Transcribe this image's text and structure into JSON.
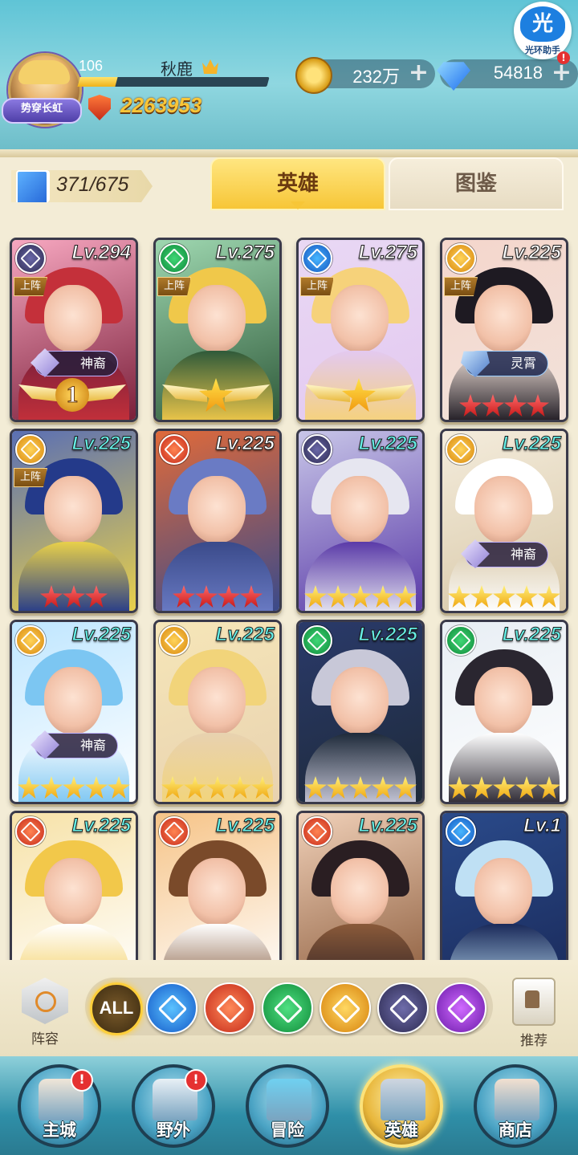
{
  "header": {
    "player_level": "106",
    "player_name": "秋鹿",
    "title_badge": "势穿长虹",
    "xp_progress": 0.2,
    "combat_power": "2263953",
    "gold": "232万",
    "gems": "54818",
    "gold_plus": "+",
    "gems_plus": "+",
    "helper_glyph": "光",
    "helper_label": "光环助手",
    "helper_alert": "!"
  },
  "tabs": {
    "hero_count": "371/675",
    "heroes": "英雄",
    "codex": "图鉴"
  },
  "heroes": [
    {
      "level": "Lv.294",
      "faction": "dark",
      "level_color": "white",
      "deployed": "上阵",
      "badge": "神裔",
      "badge_kind": "shen",
      "wings": "num",
      "wing_value": "1",
      "stars": 0,
      "star_color": "",
      "palette": [
        "#f7a7c0",
        "#c4303a",
        "#7a1f3a"
      ]
    },
    {
      "level": "Lv.275",
      "faction": "nature",
      "level_color": "white",
      "deployed": "上阵",
      "badge": "",
      "badge_kind": "",
      "wings": "star",
      "wing_value": "",
      "stars": 0,
      "star_color": "",
      "palette": [
        "#9ed7b0",
        "#f0c84a",
        "#2f5a3a"
      ]
    },
    {
      "level": "Lv.275",
      "faction": "water",
      "level_color": "white",
      "deployed": "上阵",
      "badge": "",
      "badge_kind": "",
      "wings": "star",
      "wing_value": "",
      "stars": 0,
      "star_color": "",
      "palette": [
        "#e9d8f4",
        "#f6d27a",
        "#e3c9f0"
      ]
    },
    {
      "level": "Lv.225",
      "faction": "light",
      "level_color": "white",
      "deployed": "上阵",
      "badge": "灵霄",
      "badge_kind": "ling",
      "wings": "",
      "wing_value": "",
      "stars": 4,
      "star_color": "red",
      "palette": [
        "#f4d6cc",
        "#1e1a22",
        "#f2e2da"
      ]
    },
    {
      "level": "Lv.225",
      "faction": "light",
      "level_color": "teal",
      "deployed": "上阵",
      "badge": "",
      "badge_kind": "",
      "wings": "",
      "wing_value": "",
      "stars": 3,
      "star_color": "red",
      "palette": [
        "#5a6fb4",
        "#243a8a",
        "#e8d04a"
      ]
    },
    {
      "level": "Lv.225",
      "faction": "fire",
      "level_color": "white",
      "deployed": "",
      "badge": "",
      "badge_kind": "",
      "wings": "",
      "wing_value": "",
      "stars": 4,
      "star_color": "red",
      "palette": [
        "#e06a3a",
        "#6a7bc4",
        "#3a4a8a"
      ]
    },
    {
      "level": "Lv.225",
      "faction": "dark",
      "level_color": "teal",
      "deployed": "",
      "badge": "",
      "badge_kind": "",
      "wings": "",
      "wing_value": "",
      "stars": 5,
      "star_color": "gold",
      "palette": [
        "#c8c6e8",
        "#e6e6f0",
        "#5a3aa8"
      ]
    },
    {
      "level": "Lv.225",
      "faction": "light",
      "level_color": "teal",
      "deployed": "",
      "badge": "神裔",
      "badge_kind": "shen",
      "wings": "",
      "wing_value": "",
      "stars": 5,
      "star_color": "gold",
      "palette": [
        "#f4ecdc",
        "#ffffff",
        "#d8c8a8"
      ]
    },
    {
      "level": "Lv.225",
      "faction": "light",
      "level_color": "teal",
      "deployed": "",
      "badge": "神裔",
      "badge_kind": "shen",
      "wings": "",
      "wing_value": "",
      "stars": 5,
      "star_color": "gold",
      "palette": [
        "#bfe6ff",
        "#7cc6f2",
        "#ffffff"
      ]
    },
    {
      "level": "Lv.225",
      "faction": "light",
      "level_color": "teal",
      "deployed": "",
      "badge": "",
      "badge_kind": "",
      "wings": "",
      "wing_value": "",
      "stars": 5,
      "star_color": "gold",
      "palette": [
        "#f6e6b8",
        "#f2d47a",
        "#e8d2b0"
      ]
    },
    {
      "level": "Lv.225",
      "faction": "nature",
      "level_color": "teal",
      "deployed": "",
      "badge": "",
      "badge_kind": "",
      "wings": "",
      "wing_value": "",
      "stars": 5,
      "star_color": "gold",
      "palette": [
        "#2a3a6a",
        "#c8c8d8",
        "#1e2a3a"
      ]
    },
    {
      "level": "Lv.225",
      "faction": "nature",
      "level_color": "teal",
      "deployed": "",
      "badge": "",
      "badge_kind": "",
      "wings": "",
      "wing_value": "",
      "stars": 5,
      "star_color": "gold",
      "palette": [
        "#e8eef4",
        "#2a2630",
        "#ffffff"
      ]
    },
    {
      "level": "Lv.225",
      "faction": "fire",
      "level_color": "teal",
      "deployed": "",
      "badge": "",
      "badge_kind": "",
      "wings": "",
      "wing_value": "",
      "stars": 0,
      "star_color": "",
      "palette": [
        "#f7e2a8",
        "#f2c84a",
        "#ffffff"
      ]
    },
    {
      "level": "Lv.225",
      "faction": "fire",
      "level_color": "teal",
      "deployed": "",
      "badge": "",
      "badge_kind": "",
      "wings": "",
      "wing_value": "",
      "stars": 0,
      "star_color": "",
      "palette": [
        "#f6c488",
        "#7a4a2a",
        "#ffffff"
      ]
    },
    {
      "level": "Lv.225",
      "faction": "fire",
      "level_color": "teal",
      "deployed": "",
      "badge": "",
      "badge_kind": "",
      "wings": "",
      "wing_value": "",
      "stars": 0,
      "star_color": "",
      "palette": [
        "#f0d0b8",
        "#2a1e22",
        "#8a5a3a"
      ]
    },
    {
      "level": "Lv.1",
      "faction": "water",
      "level_color": "white",
      "deployed": "",
      "badge": "",
      "badge_kind": "",
      "wings": "",
      "wing_value": "",
      "stars": 0,
      "star_color": "",
      "palette": [
        "#2a4a8a",
        "#bfe0f4",
        "#1a2a5a"
      ]
    }
  ],
  "filters": {
    "lineup": "阵容",
    "recommend": "推荐",
    "all": "ALL",
    "items": [
      "water",
      "fire",
      "nature",
      "light",
      "dark",
      "void"
    ]
  },
  "nav": [
    {
      "label": "主城",
      "alert": "!",
      "key": "main-city",
      "art": "#f0e6d8"
    },
    {
      "label": "野外",
      "alert": "!",
      "key": "wild",
      "art": "#e8f0f6"
    },
    {
      "label": "冒险",
      "alert": "",
      "key": "adventure",
      "art": "#6fd0f0"
    },
    {
      "label": "英雄",
      "alert": "",
      "key": "heroes",
      "art": "#cfd6e0"
    },
    {
      "label": "商店",
      "alert": "",
      "key": "shop",
      "art": "#f2e0d0"
    }
  ]
}
